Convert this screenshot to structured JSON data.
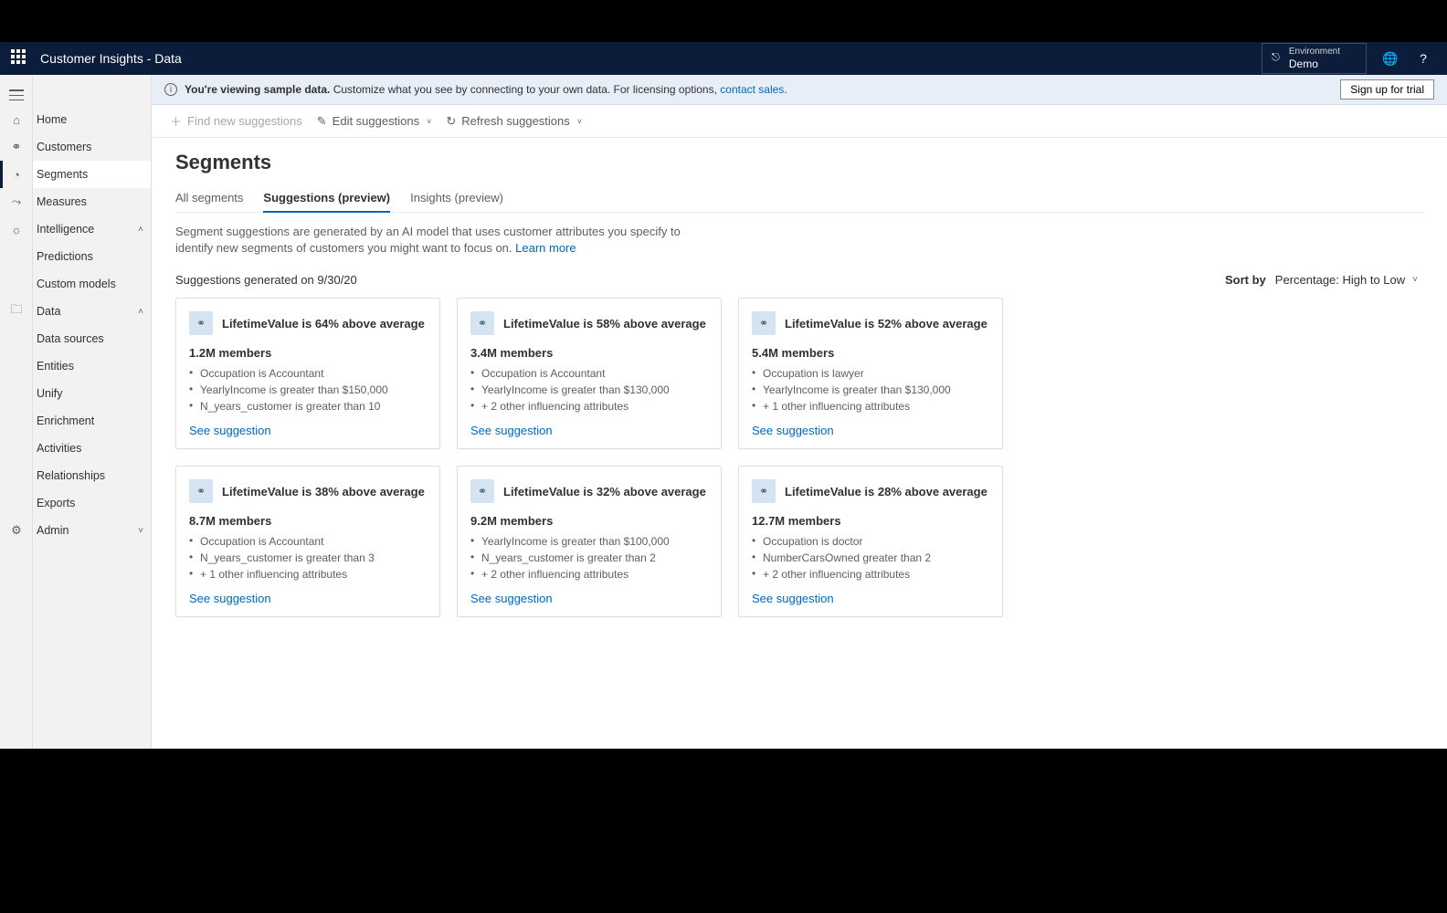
{
  "topbar": {
    "title": "Customer Insights - Data",
    "env_label": "Environment",
    "env_value": "Demo"
  },
  "notice": {
    "bold": "You're viewing sample data.",
    "rest": " Customize what you see by connecting to your own data. For licensing options, ",
    "link": "contact sales",
    "signup": "Sign up for trial"
  },
  "cmdbar": {
    "find": "Find new suggestions",
    "edit": "Edit suggestions",
    "refresh": "Refresh suggestions"
  },
  "nav": {
    "home": "Home",
    "customers": "Customers",
    "segments": "Segments",
    "measures": "Measures",
    "intelligence": "Intelligence",
    "predictions": "Predictions",
    "custom_models": "Custom models",
    "data": "Data",
    "data_sources": "Data sources",
    "entities": "Entities",
    "unify": "Unify",
    "enrichment": "Enrichment",
    "activities": "Activities",
    "relationships": "Relationships",
    "exports": "Exports",
    "admin": "Admin"
  },
  "page": {
    "title": "Segments",
    "tabs": {
      "all": "All segments",
      "suggestions": "Suggestions (preview)",
      "insights": "Insights (preview)"
    },
    "desc": "Segment suggestions are generated by an AI model that uses customer attributes you specify to identify new segments of customers you might want to focus on. ",
    "learn_more": "Learn more",
    "generated": "Suggestions generated on 9/30/20",
    "sort_label": "Sort by",
    "sort_value": "Percentage: High to Low",
    "see_suggestion": "See suggestion"
  },
  "cards": [
    {
      "title": "LifetimeValue is 64% above average",
      "members": "1.2M members",
      "bullets": [
        "Occupation is Accountant",
        "YearlyIncome is greater than $150,000",
        "N_years_customer is greater than 10"
      ]
    },
    {
      "title": "LifetimeValue is 58% above average",
      "members": "3.4M members",
      "bullets": [
        "Occupation is Accountant",
        "YearlyIncome is greater than $130,000",
        "+ 2 other influencing attributes"
      ]
    },
    {
      "title": "LifetimeValue is 52% above average",
      "members": "5.4M members",
      "bullets": [
        "Occupation is lawyer",
        "YearlyIncome is greater than $130,000",
        "+ 1 other influencing attributes"
      ]
    },
    {
      "title": "LifetimeValue is 38% above average",
      "members": "8.7M members",
      "bullets": [
        "Occupation is Accountant",
        "N_years_customer is greater than 3",
        "+ 1 other influencing attributes"
      ]
    },
    {
      "title": "LifetimeValue is 32% above average",
      "members": "9.2M members",
      "bullets": [
        "YearlyIncome is greater than $100,000",
        "N_years_customer is greater than 2",
        "+ 2 other influencing attributes"
      ]
    },
    {
      "title": "LifetimeValue is 28% above average",
      "members": "12.7M members",
      "bullets": [
        "Occupation is doctor",
        "NumberCarsOwned greater than 2",
        "+ 2 other influencing attributes"
      ]
    }
  ]
}
